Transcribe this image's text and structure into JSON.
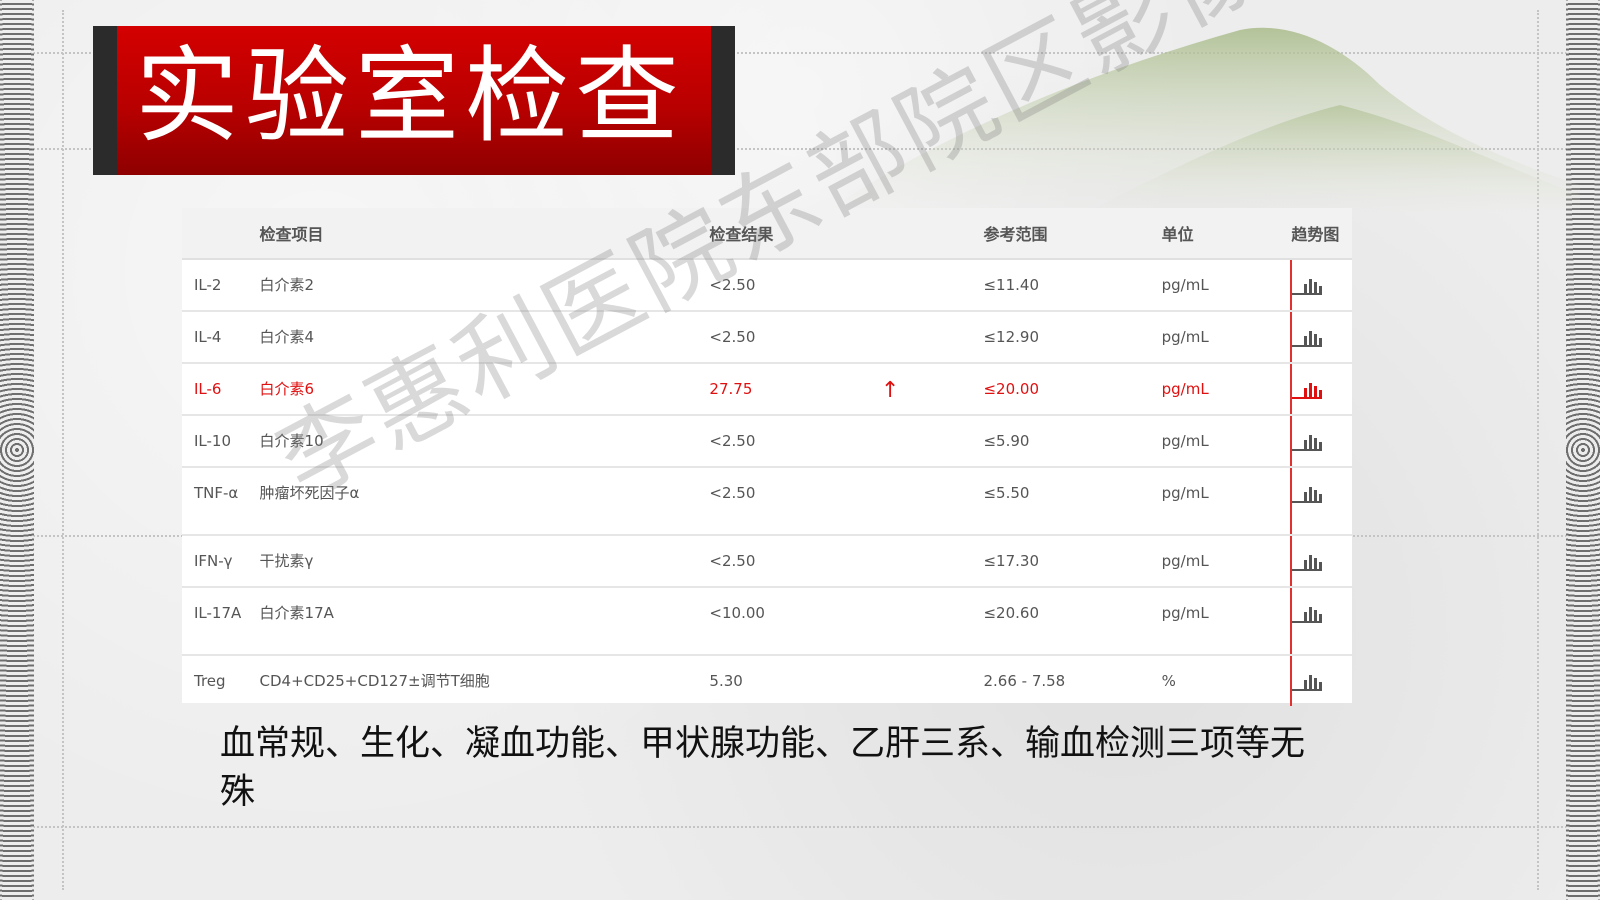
{
  "slide": {
    "title": "实验室检查",
    "watermark": "李惠利医院东部院区影像科",
    "note": "血常规、生化、凝血功能、甲状腺功能、乙肝三系、输血检测三项等无殊"
  },
  "lab_table": {
    "headers": {
      "code": "",
      "item": "检查项目",
      "result": "检查结果",
      "reference": "参考范围",
      "unit": "单位",
      "trend": "趋势图"
    },
    "rows": [
      {
        "code": "IL-2",
        "name": "白介素2",
        "result": "<2.50",
        "flag": "",
        "reference": "≤11.40",
        "unit": "pg/mL"
      },
      {
        "code": "IL-4",
        "name": "白介素4",
        "result": "<2.50",
        "flag": "",
        "reference": "≤12.90",
        "unit": "pg/mL"
      },
      {
        "code": "IL-6",
        "name": "白介素6",
        "result": "27.75",
        "flag": "↑",
        "reference": "≤20.00",
        "unit": "pg/mL"
      },
      {
        "code": "IL-10",
        "name": "白介素10",
        "result": "<2.50",
        "flag": "",
        "reference": "≤5.90",
        "unit": "pg/mL"
      },
      {
        "code": "TNF-α",
        "name": "肿瘤坏死因子α",
        "result": "<2.50",
        "flag": "",
        "reference": "≤5.50",
        "unit": "pg/mL"
      },
      {
        "code": "IFN-γ",
        "name": "干扰素γ",
        "result": "<2.50",
        "flag": "",
        "reference": "≤17.30",
        "unit": "pg/mL"
      },
      {
        "code": "IL-17A",
        "name": "白介素17A",
        "result": "<10.00",
        "flag": "",
        "reference": "≤20.60",
        "unit": "pg/mL"
      },
      {
        "code": "Treg",
        "name": "CD4+CD25+CD127±调节T细胞",
        "result": "5.30",
        "flag": "",
        "reference": "2.66 - 7.58",
        "unit": "%"
      }
    ],
    "abnormal_color": "#e01010",
    "trend_icon": "bar-chart-icon"
  }
}
